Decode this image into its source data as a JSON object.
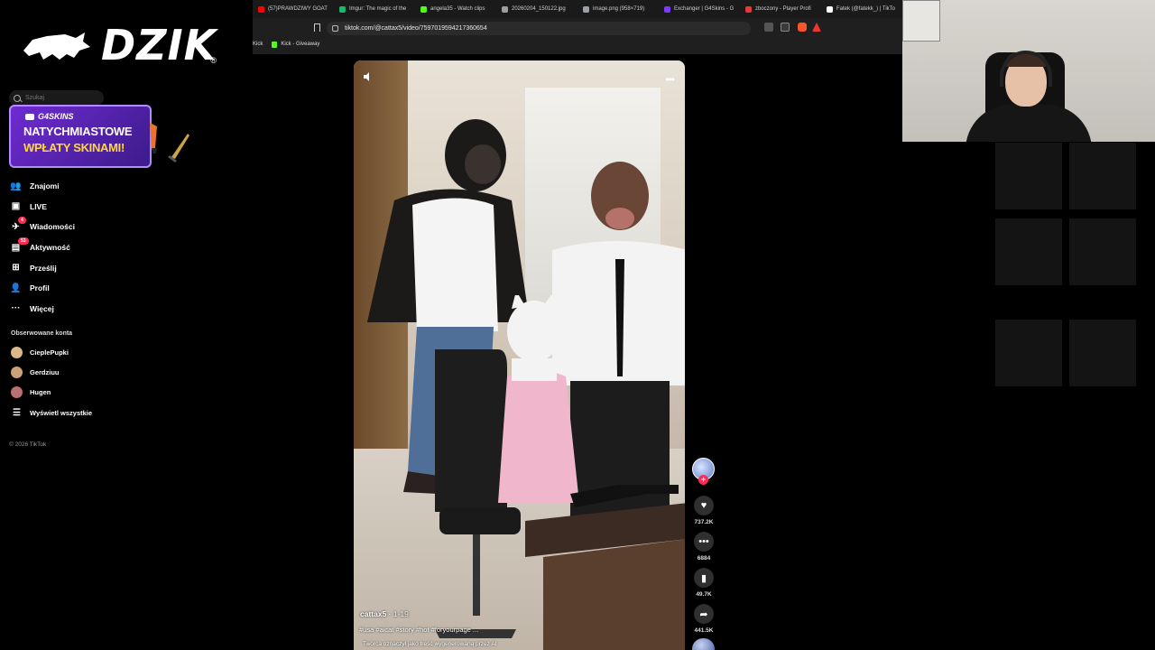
{
  "overlay": {
    "logo_text": "DZIK",
    "logo_reg": "®"
  },
  "browser": {
    "tabs": [
      {
        "title": "(57)PRAWDZIWY GOAT",
        "color": "#ff0000"
      },
      {
        "title": "Imgur: The magic of the",
        "color": "#1bb76e"
      },
      {
        "title": "angela35 - Watch clips",
        "color": "#53fc18"
      },
      {
        "title": "20260204_150122.jpg",
        "color": "#9aa0a6"
      },
      {
        "title": "image.png (958×719)",
        "color": "#9aa0a6"
      },
      {
        "title": "Exchanger | G4Skins - G",
        "color": "#7a3cff"
      },
      {
        "title": "zboczony - Player Profi",
        "color": "#e53935"
      },
      {
        "title": "Fatek (@fatekk_) | TikTo",
        "color": "#ffffff"
      }
    ],
    "url": "tiktok.com/@cattax5/video/7597019594217360654",
    "bookmarks": [
      {
        "label": "Kick",
        "kind": "text"
      },
      {
        "label": "Kick - Giveaway",
        "kind": "kick"
      }
    ]
  },
  "sidebar": {
    "search_placeholder": "Szukaj",
    "promo": {
      "brand": "G4SKINS",
      "line1": "NATYCHMIASTOWE",
      "line2": "WPŁATY SKINAMI!"
    },
    "nav": [
      {
        "label": "Znajomi",
        "icon": "friends-icon",
        "badge": ""
      },
      {
        "label": "LIVE",
        "icon": "live-icon",
        "badge": ""
      },
      {
        "label": "Wiadomości",
        "icon": "messages-icon",
        "badge": "4"
      },
      {
        "label": "Aktywność",
        "icon": "activity-icon",
        "badge": "53"
      },
      {
        "label": "Prześlij",
        "icon": "upload-icon",
        "badge": ""
      },
      {
        "label": "Profil",
        "icon": "profile-icon",
        "badge": ""
      },
      {
        "label": "Więcej",
        "icon": "more-icon",
        "badge": ""
      }
    ],
    "followed_title": "Obserwowane konta",
    "followed": [
      {
        "name": "CieplePupki",
        "color": "#d9b98a"
      },
      {
        "name": "Gerdziuu",
        "color": "#c9a27a"
      },
      {
        "name": "Hugen",
        "color": "#b97070"
      }
    ],
    "show_all": "Wyświetl wszystkie",
    "copyright": "© 2026 TikTok"
  },
  "video": {
    "author": "cattax5",
    "age": "1-19",
    "caption": "#usa #aicat #story #hot #foryourpage ...",
    "ai_notice": "Twórca oznaczył jako treść wygenerowaną przez AI"
  },
  "actions": {
    "likes": "737.2K",
    "comments": "6884",
    "saves": "49.7K",
    "shares": "441.5K"
  }
}
